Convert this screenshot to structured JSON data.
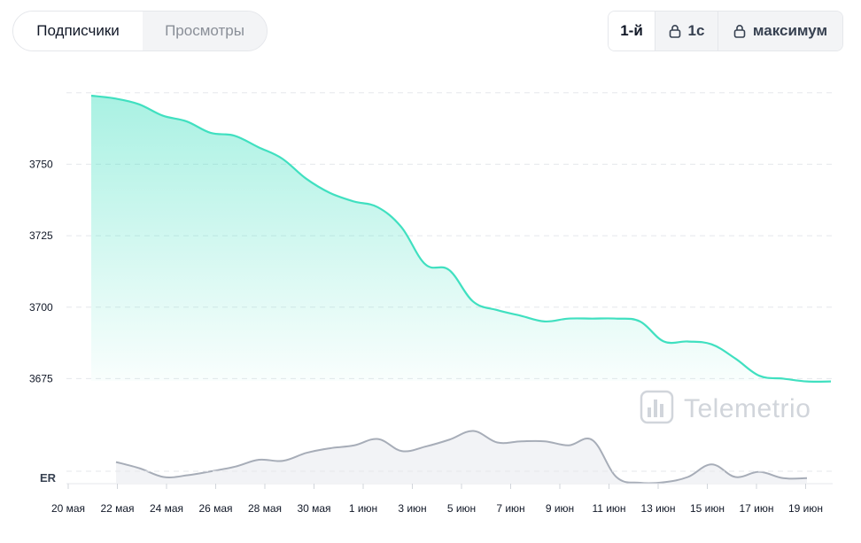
{
  "tabs": [
    {
      "label": "Подписчики",
      "active": true
    },
    {
      "label": "Просмотры",
      "active": false
    }
  ],
  "ranges": [
    {
      "label": "1-й",
      "locked": false,
      "active": true
    },
    {
      "label": "1с",
      "locked": true,
      "active": false
    },
    {
      "label": "максимум",
      "locked": true,
      "active": false
    }
  ],
  "icons": {
    "lock": "lock-icon",
    "watermark": "bar-chart-icon"
  },
  "watermark": "Telemetrio",
  "colors": {
    "accent": "#40e0c0",
    "er_line": "#a7adb8",
    "grid": "#e5e7eb"
  },
  "er_label": "ER",
  "chart_data": [
    {
      "type": "area",
      "ylim": [
        3670,
        3770
      ],
      "yticks": [
        3675,
        3700,
        3725,
        3750
      ],
      "x": [
        "20 мая",
        "21 мая",
        "22 мая",
        "23 мая",
        "24 мая",
        "25 мая",
        "26 мая",
        "27 мая",
        "28 мая",
        "29 мая",
        "30 мая",
        "31 мая",
        "1 июн",
        "2 июн",
        "3 июн",
        "4 июн",
        "5 июн",
        "6 июн",
        "7 июн",
        "8 июн",
        "9 июн",
        "10 июн",
        "11 июн",
        "12 июн",
        "13 июн",
        "14 июн",
        "15 июн",
        "16 июн",
        "17 июн",
        "18 июн",
        "19 июн",
        "20 июн"
      ],
      "xtick_labels": [
        "20 мая",
        "22 мая",
        "24 мая",
        "26 мая",
        "28 мая",
        "30 мая",
        "1 июн",
        "3 июн",
        "5 июн",
        "7 июн",
        "9 июн",
        "11 июн",
        "13 июн",
        "15 июн",
        "17 июн",
        "19 июн"
      ],
      "xtick_display": [
        "20 мая",
        "22 мая",
        "24 мая",
        "26 мая",
        "28 мая",
        "30 мая",
        "1 июн",
        "3 июн",
        "5 июн",
        "7 июн",
        "9 июн",
        "11 июн",
        "13 июн",
        "15 июн",
        "17 июн",
        "19 июн"
      ],
      "values": [
        3774,
        3773,
        3771,
        3767,
        3765,
        3761,
        3760,
        3756,
        3752,
        3745,
        3740,
        3737,
        3735,
        3728,
        3715,
        3713,
        3702,
        3699,
        3697,
        3695,
        3696,
        3696,
        3696,
        3695,
        3688,
        3688,
        3687,
        3682,
        3676,
        3675,
        3674,
        3674
      ]
    },
    {
      "type": "line",
      "name": "ER",
      "x": [
        "21 мая",
        "22 мая",
        "23 мая",
        "24 мая",
        "25 мая",
        "26 мая",
        "27 мая",
        "28 мая",
        "29 мая",
        "30 мая",
        "31 мая",
        "1 июн",
        "2 июн",
        "3 июн",
        "4 июн",
        "5 июн",
        "6 июн",
        "7 июн",
        "8 июн",
        "9 июн",
        "10 июн",
        "11 июн",
        "12 июн",
        "13 июн",
        "14 июн",
        "15 июн",
        "16 июн",
        "17 июн",
        "18 июн",
        "19 июн"
      ],
      "values": [
        0.36,
        0.25,
        0.1,
        0.13,
        0.2,
        0.28,
        0.4,
        0.38,
        0.52,
        0.6,
        0.65,
        0.76,
        0.55,
        0.63,
        0.75,
        0.9,
        0.7,
        0.72,
        0.72,
        0.65,
        0.74,
        0.1,
        0.0,
        0.01,
        0.1,
        0.32,
        0.1,
        0.19,
        0.08,
        0.08
      ]
    }
  ]
}
